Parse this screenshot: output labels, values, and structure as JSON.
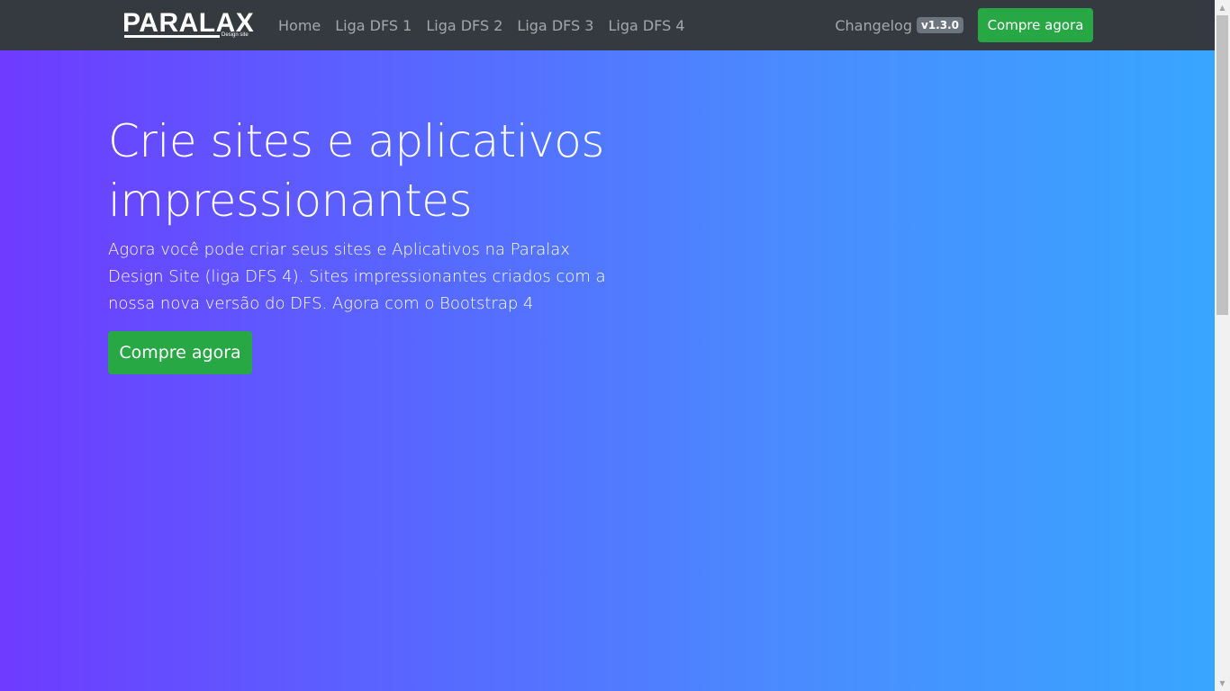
{
  "brand": {
    "name": "PARALAX",
    "tagline": "Design site"
  },
  "nav": {
    "links": [
      "Home",
      "Liga DFS 1",
      "Liga DFS 2",
      "Liga DFS 3",
      "Liga DFS 4"
    ],
    "changelog_label": "Changelog",
    "version": "v1.3.0",
    "buy_label": "Compre agora"
  },
  "hero": {
    "title": "Crie sites e aplicativos impressionantes",
    "lead": "Agora você pode criar seus sites e Aplicativos na Paralax Design Site (liga DFS 4). Sites impressionantes criados com a nossa nova versão do DFS. Agora com o Bootstrap 4",
    "buy_label": "Compre agora"
  },
  "colors": {
    "navbar": "#343a40",
    "success": "#28a745",
    "gradient_start": "#6e3bff",
    "gradient_end": "#38a6ff"
  }
}
